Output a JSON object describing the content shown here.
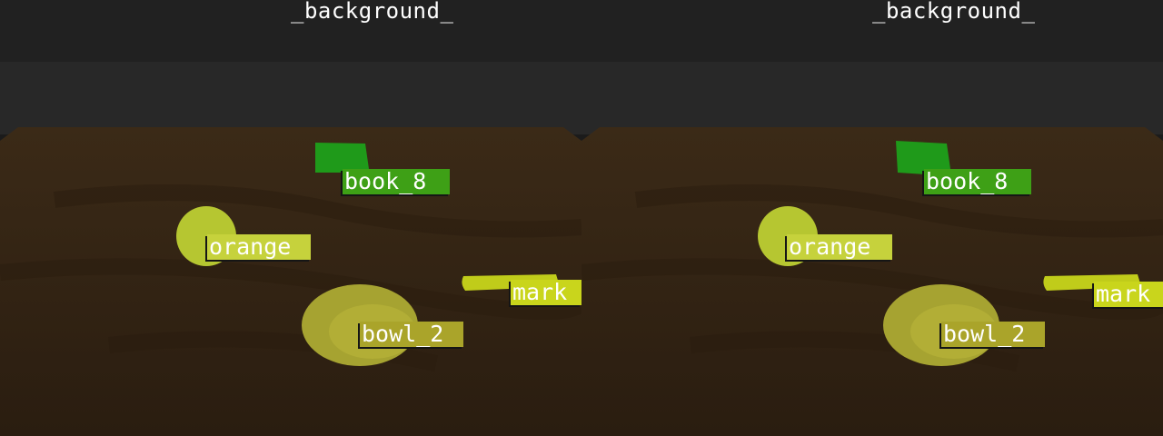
{
  "panels": [
    {
      "name": "left",
      "background_label": "_background_",
      "objects": [
        {
          "id": "book",
          "label": "book_8",
          "color": "#3ea016"
        },
        {
          "id": "orange",
          "label": "orange",
          "color": "#c6d23c"
        },
        {
          "id": "marker",
          "label": "mark",
          "color": "#c9d51c"
        },
        {
          "id": "bowl",
          "label": "bowl_2",
          "color": "#aaa42a"
        }
      ]
    },
    {
      "name": "right",
      "background_label": "_background_",
      "objects": [
        {
          "id": "book",
          "label": "book_8",
          "color": "#3ea016"
        },
        {
          "id": "orange",
          "label": "orange",
          "color": "#c6d23c"
        },
        {
          "id": "marker",
          "label": "mark",
          "color": "#c9d51c"
        },
        {
          "id": "bowl",
          "label": "bowl_2",
          "color": "#aaa42a"
        }
      ]
    }
  ],
  "colors": {
    "header": "#212121",
    "wall": "#2a2a2a",
    "table": "#3a2a17",
    "table_dark": "#261a0d",
    "mask_green": "#1f9a1a",
    "mask_yellow": "#b5c232",
    "mask_bowl": "#a6a331"
  }
}
